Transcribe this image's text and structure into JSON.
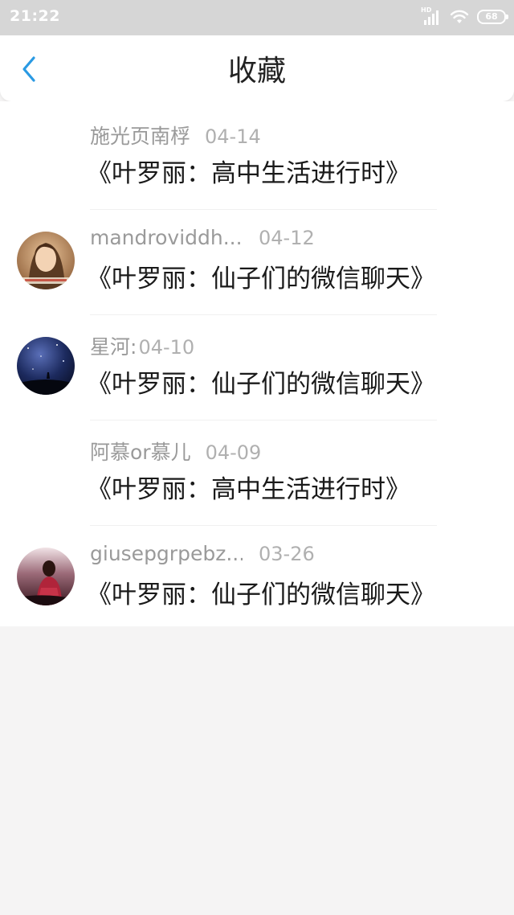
{
  "status_bar": {
    "time": "21:22",
    "network_label": "HD",
    "battery": "68"
  },
  "header": {
    "title": "收藏",
    "back_icon": "chevron-left-icon",
    "accent_color": "#2a9ae3"
  },
  "favorites": [
    {
      "username": "施光页南桴",
      "date": "04-14",
      "title": "《叶罗丽：高中生活进行时》",
      "has_avatar": false
    },
    {
      "username": "mandroviddh...",
      "date": "04-12",
      "title": "《叶罗丽：仙子们的微信聊天》",
      "has_avatar": true
    },
    {
      "username": "星河:",
      "date": "04-10",
      "title": "《叶罗丽：仙子们的微信聊天》",
      "has_avatar": true
    },
    {
      "username": "阿慕or慕儿",
      "date": "04-09",
      "title": "《叶罗丽：高中生活进行时》",
      "has_avatar": false
    },
    {
      "username": "giusepgrpebz...",
      "date": "03-26",
      "title": "《叶罗丽：仙子们的微信聊天》",
      "has_avatar": true
    }
  ]
}
